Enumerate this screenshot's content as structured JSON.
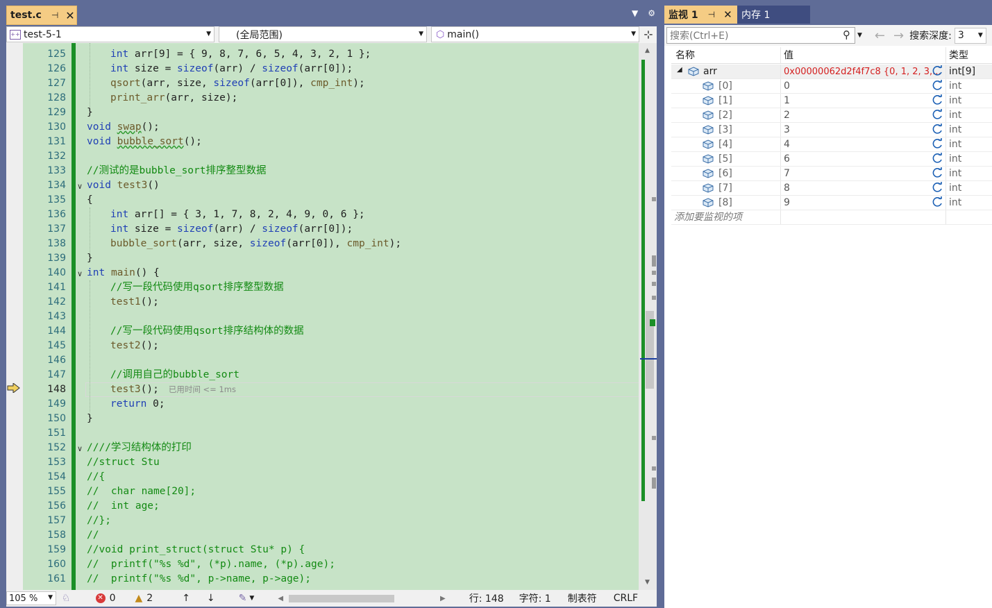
{
  "editor": {
    "tab_title": "test.c",
    "project_combo": "test-5-1",
    "scope_combo": "(全局范围)",
    "member_combo": "main()",
    "lines": [
      {
        "n": "125"
      },
      {
        "n": "126"
      },
      {
        "n": "127"
      },
      {
        "n": "128"
      },
      {
        "n": "129"
      },
      {
        "n": "130"
      },
      {
        "n": "131"
      },
      {
        "n": "132"
      },
      {
        "n": "133"
      },
      {
        "n": "134"
      },
      {
        "n": "135"
      },
      {
        "n": "136"
      },
      {
        "n": "137"
      },
      {
        "n": "138"
      },
      {
        "n": "139"
      },
      {
        "n": "140"
      },
      {
        "n": "141"
      },
      {
        "n": "142"
      },
      {
        "n": "143"
      },
      {
        "n": "144"
      },
      {
        "n": "145"
      },
      {
        "n": "146"
      },
      {
        "n": "147"
      },
      {
        "n": "148"
      },
      {
        "n": "149"
      },
      {
        "n": "150"
      },
      {
        "n": "151"
      },
      {
        "n": "152"
      },
      {
        "n": "153"
      },
      {
        "n": "154"
      },
      {
        "n": "155"
      },
      {
        "n": "156"
      },
      {
        "n": "157"
      },
      {
        "n": "158"
      },
      {
        "n": "159"
      },
      {
        "n": "160"
      },
      {
        "n": "161"
      }
    ],
    "code": {
      "l125a": "int",
      "l125b": " arr[9] = { 9, 8, 7, 6, 5, 4, 3, 2, 1 };",
      "l126a": "int",
      "l126b": " size = ",
      "l126c": "sizeof",
      "l126d": "(arr) / ",
      "l126e": "sizeof",
      "l126f": "(arr[0]);",
      "l127a": "qsort",
      "l127b": "(arr, size, ",
      "l127c": "sizeof",
      "l127d": "(arr[0]), ",
      "l127e": "cmp_int",
      "l127f": ");",
      "l128a": "print_arr",
      "l128b": "(arr, size);",
      "l129": "}",
      "l130a": "void",
      "l130b": " ",
      "l130c": "swap",
      "l130d": "();",
      "l131a": "void",
      "l131b": " ",
      "l131c": "bubble_sort",
      "l131d": "();",
      "l133": "//测试的是bubble_sort排序整型数据",
      "l134a": "void",
      "l134b": " ",
      "l134c": "test3",
      "l134d": "()",
      "l135": "{",
      "l136a": "int",
      "l136b": " arr[] = { 3, 1, 7, 8, 2, 4, 9, 0, 6 };",
      "l137a": "int",
      "l137b": " size = ",
      "l137c": "sizeof",
      "l137d": "(arr) / ",
      "l137e": "sizeof",
      "l137f": "(arr[0]);",
      "l138a": "bubble_sort",
      "l138b": "(arr, size, ",
      "l138c": "sizeof",
      "l138d": "(arr[0]), ",
      "l138e": "cmp_int",
      "l138f": ");",
      "l139": "}",
      "l140a": "int",
      "l140b": " ",
      "l140c": "main",
      "l140d": "() {",
      "l141": "//写一段代码使用qsort排序整型数据",
      "l142a": "test1",
      "l142b": "();",
      "l144": "//写一段代码使用qsort排序结构体的数据",
      "l145a": "test2",
      "l145b": "();",
      "l147": "//调用自己的bubble_sort",
      "l148a": "test3",
      "l148b": "();",
      "l148hint": "已用时间 <= 1ms",
      "l149a": "return",
      "l149b": " 0;",
      "l150": "}",
      "l152": "////学习结构体的打印",
      "l153": "//struct Stu",
      "l154": "//{",
      "l155": "//  char name[20];",
      "l156": "//  int age;",
      "l157": "//};",
      "l158": "//",
      "l159": "//void print_struct(struct Stu* p) {",
      "l160": "//  printf(\"%s %d\", (*p).name, (*p).age);",
      "l161": "//  printf(\"%s %d\", p->name, p->age);"
    }
  },
  "status": {
    "zoom": "105 %",
    "errors": "0",
    "warnings": "2",
    "row": "行: 148",
    "col": "字符: 1",
    "tabs": "制表符",
    "eol": "CRLF"
  },
  "watch": {
    "tab1": "监视 1",
    "tab2": "内存 1",
    "search_placeholder": "搜索(Ctrl+E)",
    "depth_label": "搜索深度:",
    "depth_value": "3",
    "col_name": "名称",
    "col_value": "值",
    "col_type": "类型",
    "root": {
      "name": "arr",
      "value": "0x00000062d2f4f7c8 {0, 1, 2, 3,...",
      "type": "int[9]"
    },
    "items": [
      {
        "name": "[0]",
        "value": "0",
        "type": "int"
      },
      {
        "name": "[1]",
        "value": "1",
        "type": "int"
      },
      {
        "name": "[2]",
        "value": "2",
        "type": "int"
      },
      {
        "name": "[3]",
        "value": "3",
        "type": "int"
      },
      {
        "name": "[4]",
        "value": "4",
        "type": "int"
      },
      {
        "name": "[5]",
        "value": "6",
        "type": "int"
      },
      {
        "name": "[6]",
        "value": "7",
        "type": "int"
      },
      {
        "name": "[7]",
        "value": "8",
        "type": "int"
      },
      {
        "name": "[8]",
        "value": "9",
        "type": "int"
      }
    ],
    "add_item": "添加要监视的项"
  }
}
